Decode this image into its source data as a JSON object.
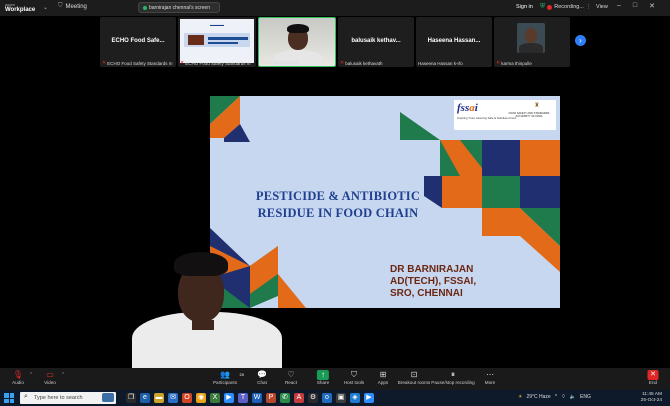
{
  "app": {
    "brand_small": "zoom",
    "brand_name": "Workplace",
    "meeting_label": "Meeting",
    "share_banner": "barnirajan chennai's screen",
    "sign_in": "Sign in",
    "recording_label": "Recording...",
    "view_label": "View"
  },
  "participants": [
    {
      "display": "ECHO Food Safe...",
      "caption": "ECHO Food Safety Standards m"
    },
    {
      "display": "",
      "caption": "ECHO Food Safety Standards m"
    },
    {
      "display": "",
      "caption": "barnirajan chennai"
    },
    {
      "display": "balusaik kethav...",
      "caption": "balusaik kethavath"
    },
    {
      "display": "Haseena Hassan...",
      "caption": "Haseena Hassan k-rfo"
    },
    {
      "display": "",
      "caption": "karma thinpulle"
    }
  ],
  "slide": {
    "title_line1": "PESTICIDE & ANTIBIOTIC",
    "title_line2": "RESIDUE IN FOOD CHAIN",
    "presenter_line1": "DR BARNIRAJAN",
    "presenter_line2": "AD(TECH), FSSAI,",
    "presenter_line3": "SRO, CHENNAI",
    "fssai_logo_a": "fss",
    "fssai_logo_b": "a",
    "fssai_logo_c": "i",
    "fssai_tagline": "Inspiring Trust, Assuring Safe & Nutritious Food",
    "fssai_org": "FOOD SAFETY AND STANDARDS AUTHORITY OF INDIA",
    "colors": {
      "navy": "#1f2f6f",
      "orange": "#e36a18",
      "green": "#1f7a4c",
      "light_blue": "#c8d7f0"
    }
  },
  "toolbar": {
    "audio": "Audio",
    "video": "Video",
    "participants": "Participants",
    "participants_count": "20",
    "chat": "Chat",
    "react": "React",
    "share": "Share",
    "host_tools": "Host tools",
    "apps": "Apps",
    "breakout_rooms": "Breakout rooms",
    "pause_recording": "Pause/stop recording",
    "more": "More",
    "end": "End"
  },
  "taskbar": {
    "search_placeholder": "Type here to search",
    "weather": "29°C  Haze",
    "lang": "ENG",
    "time": "11:45 AM",
    "date": "25-Oct-24"
  }
}
